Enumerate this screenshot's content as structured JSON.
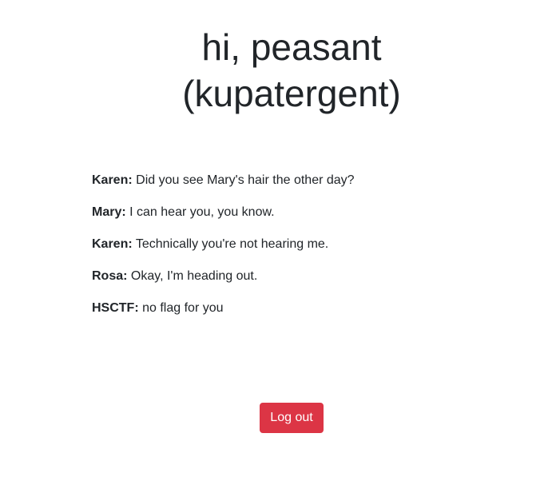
{
  "header": {
    "greeting_line1": "hi, peasant",
    "greeting_line2": "(kupatergent)"
  },
  "messages": [
    {
      "speaker": "Karen:",
      "text": "Did you see Mary's hair the other day?"
    },
    {
      "speaker": "Mary:",
      "text": "I can hear you, you know."
    },
    {
      "speaker": "Karen:",
      "text": "Technically you're not hearing me."
    },
    {
      "speaker": "Rosa:",
      "text": "Okay, I'm heading out."
    },
    {
      "speaker": "HSCTF:",
      "text": "no flag for you"
    }
  ],
  "actions": {
    "logout_label": "Log out"
  },
  "colors": {
    "text": "#212529",
    "logout_button_bg": "#dc3545",
    "logout_button_text": "#ffffff",
    "background": "#ffffff"
  }
}
